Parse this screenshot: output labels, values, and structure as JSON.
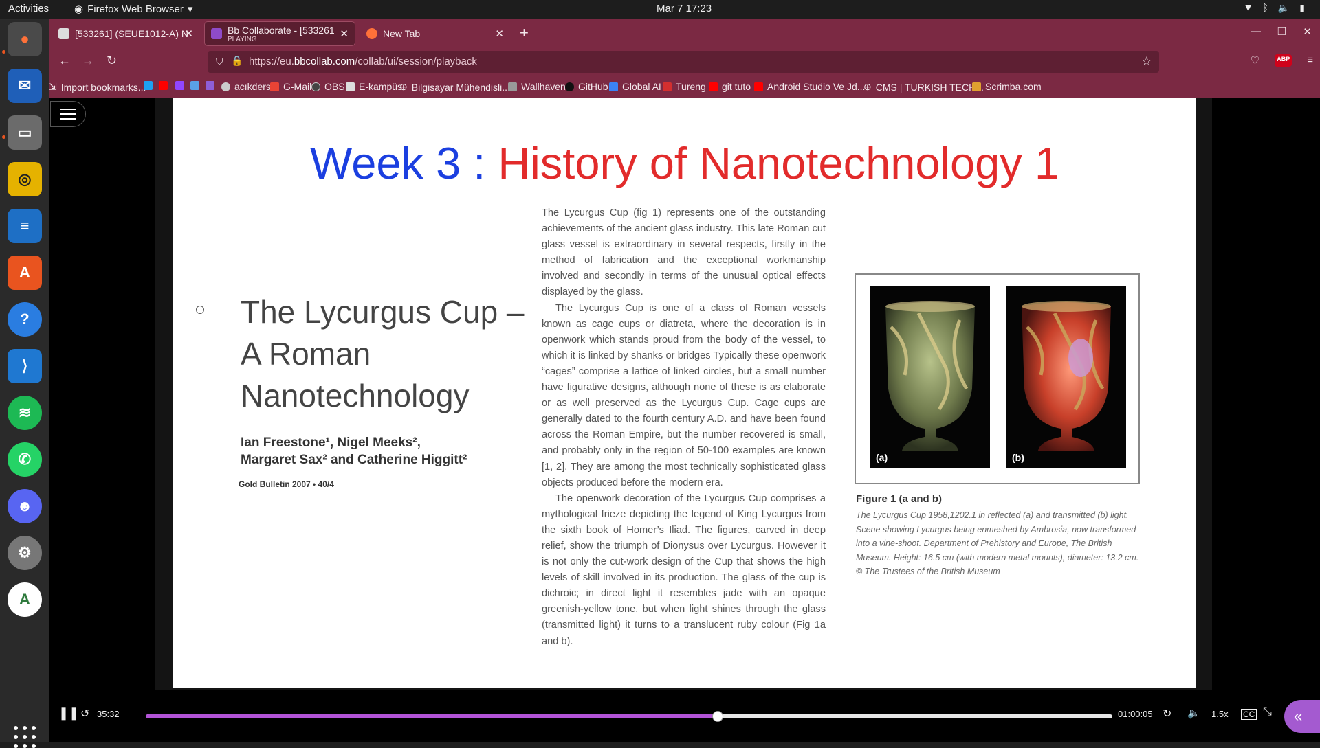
{
  "topbar": {
    "activities": "Activities",
    "app_name": "Firefox Web Browser",
    "clock": "Mar 7  17:23"
  },
  "dock": {
    "items": [
      "firefox-icon",
      "thunderbird-icon",
      "files-icon",
      "rhythmbox-icon",
      "writer-icon",
      "app-center-icon",
      "help-icon",
      "vscode-icon",
      "spotify-icon",
      "whatsapp-icon",
      "discord-icon",
      "settings-icon",
      "android-studio-icon"
    ]
  },
  "tabs": [
    {
      "title": "[533261] (SEUE1012-A) N",
      "subtitle": ""
    },
    {
      "title": "Bb Collaborate - [533261",
      "subtitle": "PLAYING"
    },
    {
      "title": "New Tab",
      "subtitle": ""
    }
  ],
  "url": {
    "prefix": "https://eu.",
    "domain": "bbcollab.com",
    "path": "/collab/ui/session/playback"
  },
  "bookmarks": [
    "Import bookmarks...",
    "acıkders",
    "G-Mail",
    "OBS",
    "E-kampüs",
    "Bilgisayar Mühendisli...",
    "Wallhaven",
    "GitHub",
    "Global AI",
    "Tureng",
    "git tuto",
    "Android Studio Ve Jd...",
    "CMS | TURKISH TECH...",
    "Scrimba.com"
  ],
  "slide": {
    "title_week": "Week 3 : ",
    "title_topic": "History of Nanotechnology 1",
    "paper_title": "The Lycurgus Cup – A Roman Nanotechnology",
    "authors_line1": "Ian Freestone¹, Nigel Meeks²,",
    "authors_line2": "Margaret Sax² and Catherine Higgitt²",
    "bulletin": "Gold Bulletin 2007 • 40/4",
    "paragraphs": [
      "The Lycurgus Cup (fig 1) represents one of the outstanding achievements of the ancient glass industry. This late Roman cut glass vessel is extraordinary in several respects, firstly in the method of fabrication and the exceptional workmanship involved and secondly in terms of the unusual optical effects displayed by the glass.",
      "The Lycurgus Cup is one of a class of Roman vessels known as cage cups or diatreta, where the decoration is in openwork which stands proud from the body of the vessel, to which it is linked by shanks or bridges Typically these openwork “cages” comprise a lattice of linked circles, but a small number have figurative designs, although none of these is as elaborate or as well preserved as the Lycurgus Cup. Cage cups are generally dated to the fourth century A.D. and have been found across the Roman Empire, but the number recovered is small, and probably only in the region of 50-100 examples are known [1, 2]. They are among the most technically sophisticated glass objects produced before the modern era.",
      "The openwork decoration of the Lycurgus Cup comprises a mythological frieze depicting the legend of King Lycurgus from the sixth book of Homer’s Iliad. The figures, carved in deep relief, show the triumph of Dionysus over Lycurgus. However it is not only the cut-work design of the Cup that shows the high levels of skill involved in its production. The glass of the cup is dichroic; in direct light it resembles jade with an opaque greenish-yellow tone, but when light shines through the glass (transmitted light) it turns to a translucent ruby colour (Fig 1a and b)."
    ],
    "figure_label_a": "(a)",
    "figure_label_b": "(b)",
    "figure_title": "Figure 1 (a and b)",
    "figure_caption": "The Lycurgus Cup 1958,1202.1 in reflected (a) and transmitted (b) light. Scene showing Lycurgus being enmeshed by Ambrosia, now transformed into a vine-shoot. Department of Prehistory and Europe, The British Museum. Height: 16.5 cm (with modern metal mounts), diameter: 13.2 cm. © The Trustees of the British Museum"
  },
  "player": {
    "current_time": "35:32",
    "total_time": "01:00:05",
    "progress": 0.592,
    "speed": "1.5x"
  },
  "colors": {
    "tab_bar": "#7b2943",
    "accent": "#b253d6",
    "week_blue": "#1b3fe0",
    "topic_red": "#e22b2b"
  }
}
